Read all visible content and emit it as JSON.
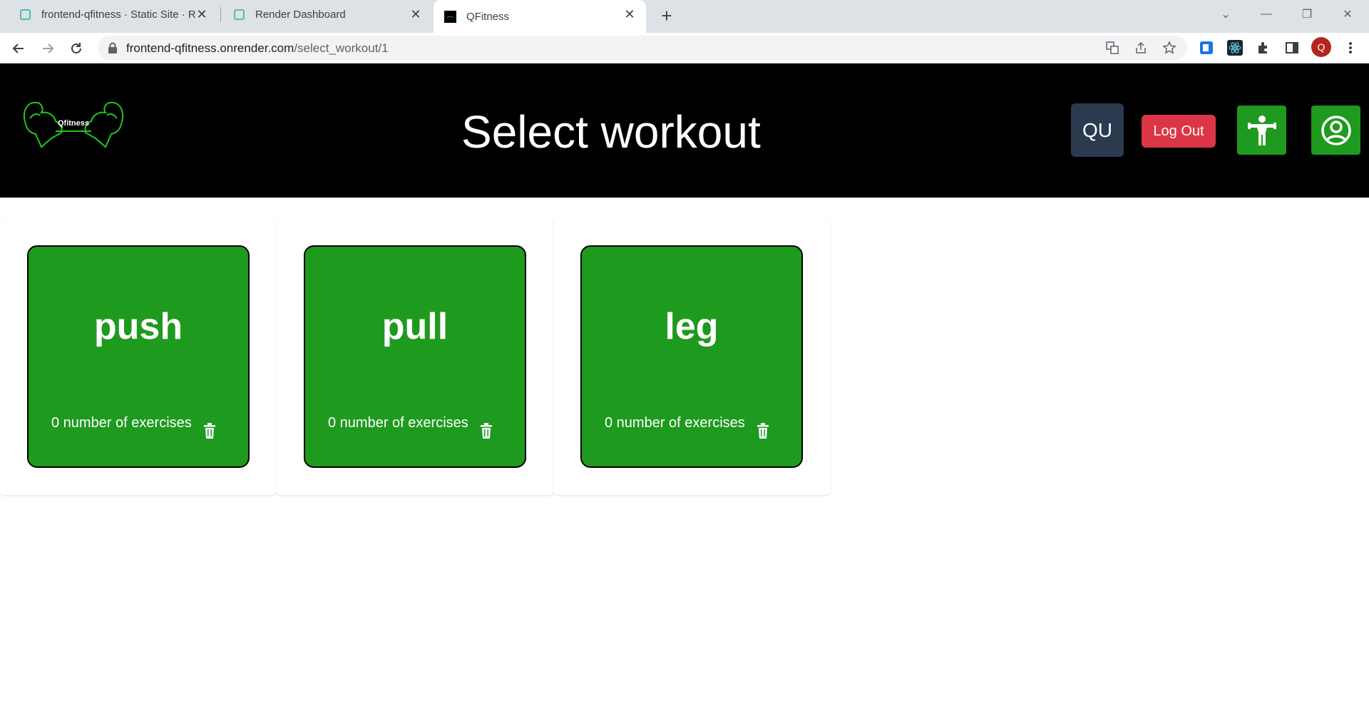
{
  "browser": {
    "tabs": [
      {
        "title": "frontend-qfitness · Static Site · R",
        "active": false
      },
      {
        "title": "Render Dashboard",
        "active": false
      },
      {
        "title": "QFitness",
        "active": true
      }
    ],
    "url_host": "frontend-qfitness.onrender.com",
    "url_path": "/select_workout/1",
    "profile_initial": "Q"
  },
  "header": {
    "logo_text": "Qfitness",
    "title": "Select workout",
    "user_initials": "QU",
    "logout_label": "Log Out"
  },
  "workouts": [
    {
      "name": "push",
      "exercises": "0 number of exercises"
    },
    {
      "name": "pull",
      "exercises": "0 number of exercises"
    },
    {
      "name": "leg",
      "exercises": "0 number of exercises"
    }
  ],
  "colors": {
    "header_bg": "#000000",
    "card_green": "#1e9a1e",
    "logout_red": "#dc3545",
    "user_badge": "#2b3a4f"
  }
}
